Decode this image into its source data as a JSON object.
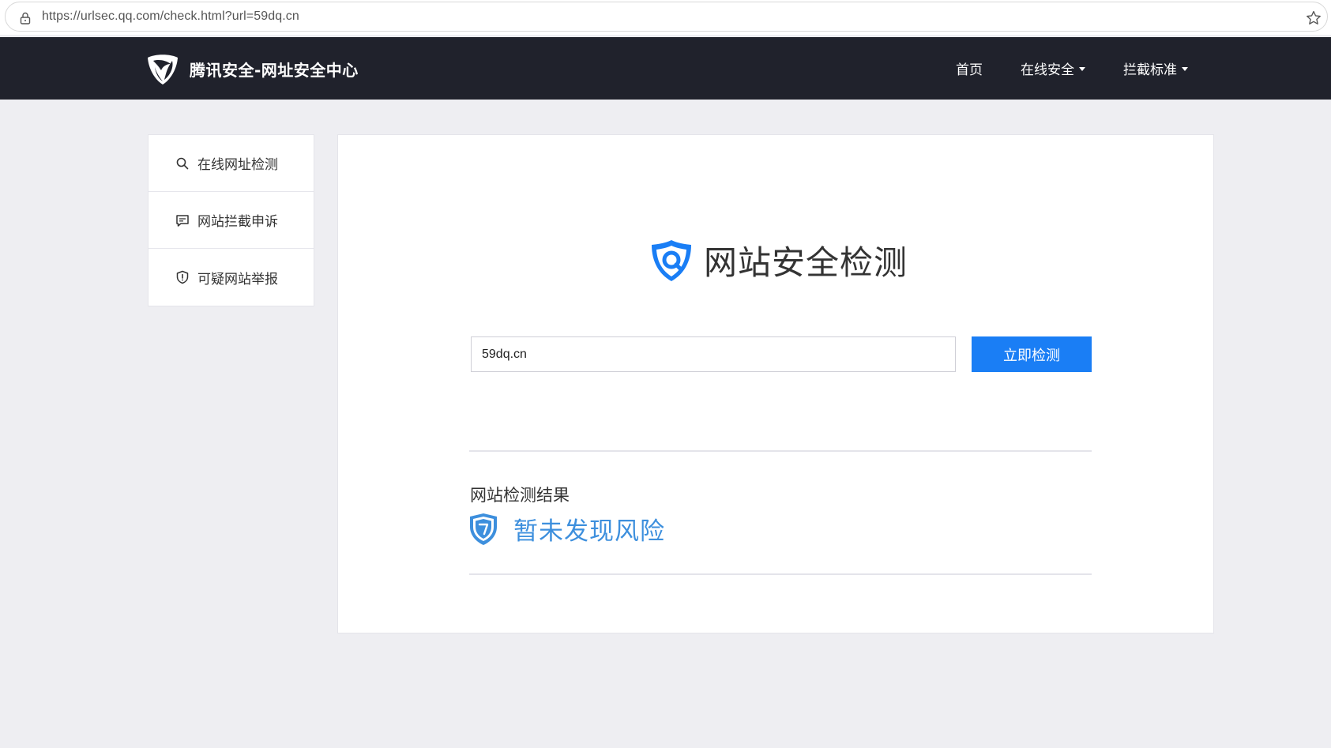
{
  "browser": {
    "url": "https://urlsec.qq.com/check.html?url=59dq.cn"
  },
  "header": {
    "brand_title": "腾讯安全-网址安全中心",
    "nav": [
      {
        "label": "首页",
        "has_dropdown": false
      },
      {
        "label": "在线安全",
        "has_dropdown": true
      },
      {
        "label": "拦截标准",
        "has_dropdown": true
      }
    ]
  },
  "sidebar": {
    "items": [
      {
        "label": "在线网址检测",
        "icon": "search-icon"
      },
      {
        "label": "网站拦截申诉",
        "icon": "message-icon"
      },
      {
        "label": "可疑网站举报",
        "icon": "shield-alert-icon"
      }
    ]
  },
  "main": {
    "title": "网站安全检测",
    "input_value": "59dq.cn",
    "check_button_label": "立即检测",
    "result_heading": "网站检测结果",
    "result_text": "暂未发现风险"
  },
  "colors": {
    "nav_bg": "#20222c",
    "accent": "#1a7ef5",
    "result_blue": "#3d8fdd",
    "page_bg": "#eeeef2"
  }
}
